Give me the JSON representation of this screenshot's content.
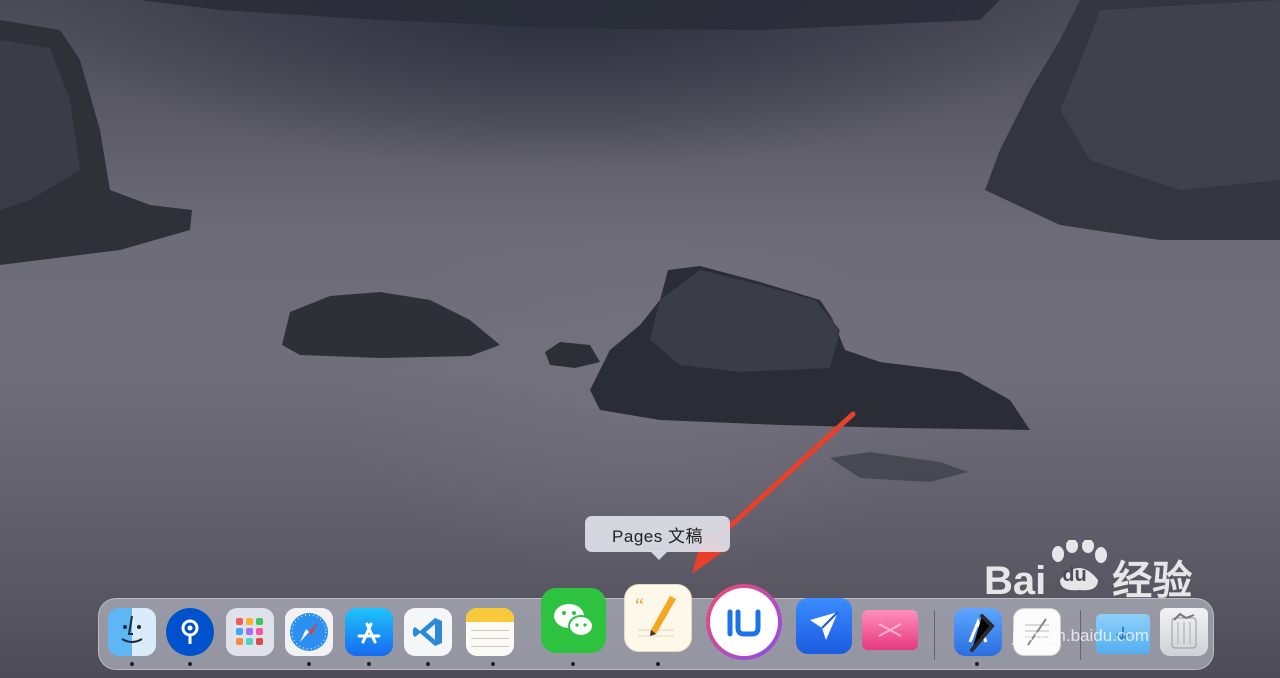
{
  "tooltip": {
    "text": "Pages 文稿"
  },
  "watermark": {
    "brand": "Bai",
    "paw_text": "du",
    "name": "经验",
    "url": "jingyan.baidu.com"
  },
  "dock": {
    "apps": [
      {
        "name": "finder",
        "icon": "finder-icon",
        "running": true
      },
      {
        "name": "sourcetree",
        "icon": "sourcetree-icon",
        "running": true
      },
      {
        "name": "launchpad",
        "icon": "launchpad-icon",
        "running": false
      },
      {
        "name": "safari",
        "icon": "safari-icon",
        "running": true
      },
      {
        "name": "app-store",
        "icon": "app-store-icon",
        "running": true
      },
      {
        "name": "vscode",
        "icon": "vscode-icon",
        "running": true
      },
      {
        "name": "notes",
        "icon": "notes-icon",
        "running": true
      },
      {
        "name": "wechat",
        "icon": "wechat-icon",
        "running": true
      },
      {
        "name": "pages",
        "icon": "pages-icon",
        "running": true
      },
      {
        "name": "iu",
        "icon": "iu-icon",
        "running": false
      },
      {
        "name": "feishu",
        "icon": "feishu-icon",
        "running": false
      },
      {
        "name": "cleanmymac",
        "icon": "cleanmymac-icon",
        "running": false
      },
      {
        "name": "xcode",
        "icon": "xcode-icon",
        "running": true
      },
      {
        "name": "textedit",
        "icon": "textedit-icon",
        "running": false
      },
      {
        "name": "downloads-folder",
        "icon": "folder-icon",
        "running": false
      },
      {
        "name": "trash",
        "icon": "trash-icon",
        "running": false
      }
    ]
  },
  "colors": {
    "arrow": "#e8402a",
    "dock_bg": "#cdd2de"
  }
}
